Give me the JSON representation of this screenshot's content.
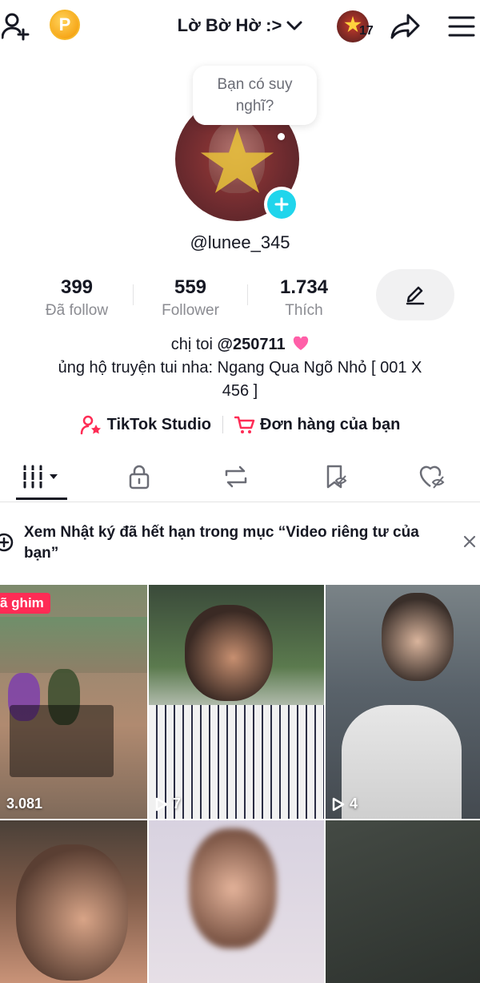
{
  "header": {
    "username_title": "Lờ Bờ Hờ :>",
    "story_count": "17",
    "coin_letter": "P"
  },
  "profile": {
    "thought_bubble": "Bạn có suy nghĩ?",
    "handle": "@lunee_345"
  },
  "stats": [
    {
      "value": "399",
      "label": "Đã follow"
    },
    {
      "value": "559",
      "label": "Follower"
    },
    {
      "value": "1.734",
      "label": "Thích"
    }
  ],
  "bio": {
    "line1_prefix": "chị toi",
    "line1_mention": "@250711",
    "line2": "ủng hộ truyện tui nha: Ngang Qua Ngõ Nhỏ [ 001 X",
    "line3": "456 ]"
  },
  "links": {
    "studio": "TikTok Studio",
    "orders": "Đơn hàng của bạn"
  },
  "notice": {
    "text": "Xem Nhật ký đã hết hạn trong mục “Video riêng tư của bạn”"
  },
  "videos": [
    {
      "badge": "ã ghim",
      "views": "3.081",
      "show_play": false
    },
    {
      "badge": "",
      "views": "7",
      "show_play": true
    },
    {
      "badge": "",
      "views": "4",
      "show_play": true
    },
    {
      "badge": "",
      "views": "",
      "show_play": false
    },
    {
      "badge": "",
      "views": "",
      "show_play": false
    },
    {
      "badge": "",
      "views": "",
      "show_play": false
    }
  ],
  "colors": {
    "accent_red": "#fe2c55",
    "plus_cyan": "#20d5ec",
    "text_primary": "#161823",
    "text_secondary": "#8a8b91"
  }
}
